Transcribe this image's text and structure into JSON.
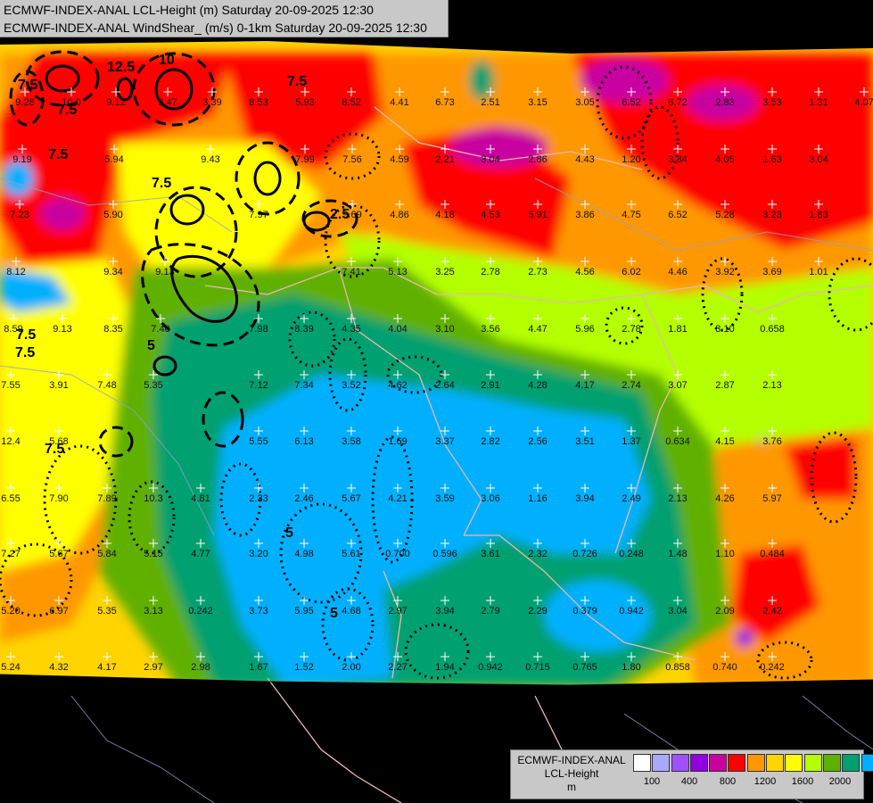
{
  "title": {
    "line1": "ECMWF-INDEX-ANAL LCL-Height (m) Saturday 20-09-2025 12:30",
    "line2": "ECMWF-INDEX-ANAL WindShear_ (m/s) 0-1km Saturday 20-09-2025 12:30"
  },
  "legend": {
    "line1": "ECMWF-INDEX-ANAL",
    "line2": "LCL-Height",
    "line3": "m",
    "colors": [
      "#ffffff",
      "#a8a8ff",
      "#a050ff",
      "#9000e0",
      "#c800a0",
      "#ff0000",
      "#ff9800",
      "#ffd400",
      "#ffff00",
      "#b4ff00",
      "#60b000",
      "#00a070",
      "#00b0ff"
    ],
    "ticks": [
      "100",
      "400",
      "800",
      "1200",
      "1600",
      "2000"
    ]
  },
  "contour_labels": [
    "7.5",
    "10",
    "7.5",
    "7.5",
    "12.5",
    "7.5",
    "2.5",
    "7.5",
    "7.5",
    "5",
    "5",
    "5",
    "7.5",
    "7.5"
  ],
  "values": [
    "9.28",
    "10.0",
    "9.12",
    "9.47",
    "3.39",
    "8.53",
    "5.93",
    "8.52",
    "4.41",
    "6.73",
    "2.51",
    "3.15",
    "3.05",
    "6.52",
    "6.72",
    "2.83",
    "3.53",
    "1.31",
    "4.07",
    "9.19",
    "5.94",
    "9.43",
    "7.99",
    "7.56",
    "4.59",
    "2.21",
    "3.04",
    "2.86",
    "4.43",
    "1.20",
    "3.84",
    "4.05",
    "1.63",
    "3.04",
    "7.23",
    "5.90",
    "7.97",
    "9.69",
    "4.86",
    "4.18",
    "4.53",
    "5.91",
    "3.86",
    "4.75",
    "6.52",
    "5.28",
    "3.23",
    "1.83",
    "8.12",
    "9.34",
    "9.13",
    "7.41",
    "5.13",
    "3.25",
    "2.78",
    "2.73",
    "4.56",
    "6.02",
    "4.46",
    "3.92",
    "3.69",
    "1.01",
    "8.59",
    "9.13",
    "8.35",
    "7.40",
    "7.98",
    "8.39",
    "4.35",
    "4.04",
    "3.10",
    "3.56",
    "4.47",
    "5.96",
    "2.78",
    "1.81",
    "3.10",
    "0.658",
    "7.55",
    "3.91",
    "7.48",
    "5.35",
    "7.12",
    "7.34",
    "3.52",
    "4.62",
    "2.64",
    "2.91",
    "4.28",
    "4.17",
    "2.74",
    "3.07",
    "2.87",
    "2.13",
    "12.4",
    "5.68",
    "5.55",
    "6.13",
    "3.58",
    "1.69",
    "3.37",
    "2.82",
    "2.56",
    "3.51",
    "1.37",
    "0.634",
    "4.15",
    "3.76",
    "6.55",
    "7.90",
    "7.89",
    "10.3",
    "4.81",
    "2.33",
    "2.46",
    "5.67",
    "4.21",
    "3.59",
    "3.06",
    "1.16",
    "3.94",
    "2.49",
    "2.13",
    "4.26",
    "5.97",
    "7.27",
    "5.67",
    "5.84",
    "5.15",
    "4.77",
    "3.20",
    "4.98",
    "5.61",
    "0.700",
    "0.596",
    "3.61",
    "2.32",
    "0.726",
    "0.248",
    "1.48",
    "1.10",
    "0.484",
    "5.20",
    "6.97",
    "5.35",
    "3.13",
    "0.242",
    "3.73",
    "5.95",
    "4.68",
    "2.97",
    "3.94",
    "2.79",
    "2.29",
    "0.379",
    "0.942",
    "3.04",
    "2.09",
    "2.42",
    "5.24",
    "4.32",
    "4.17",
    "2.97",
    "2.98",
    "1.67",
    "1.52",
    "2.00",
    "2.27",
    "1.94",
    "0.942",
    "0.715",
    "0.765",
    "1.80",
    "0.858",
    "0.740",
    "0.242"
  ]
}
